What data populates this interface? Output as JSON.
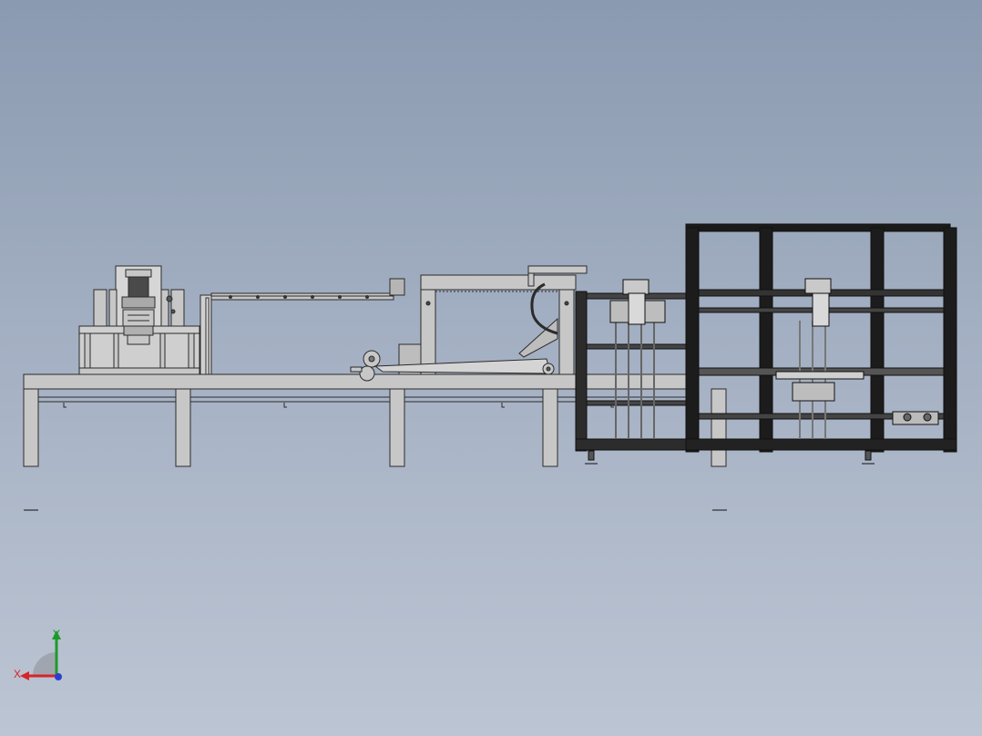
{
  "viewport": {
    "background_top": "#8a9ab0",
    "background_bottom": "#bcc5d3"
  },
  "model": {
    "frame_fill": "#c7c7c7",
    "line_color": "#2b2b2b",
    "dark_frame": "#1a1a1a"
  },
  "triad": {
    "x_label": "X",
    "y_label": "Y",
    "x_color": "#d8232a",
    "y_color": "#1f9a2a",
    "z_color": "#2a3fd0"
  }
}
